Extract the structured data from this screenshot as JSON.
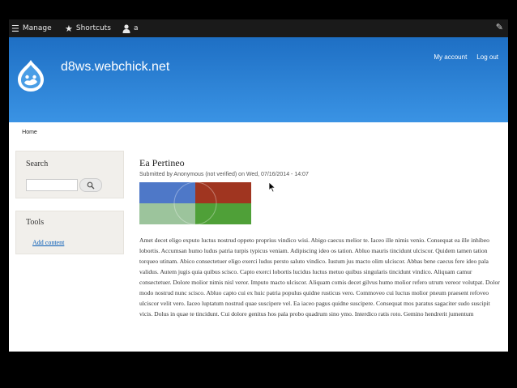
{
  "toolbar": {
    "manage_label": "Manage",
    "shortcuts_label": "Shortcuts",
    "user_label": "a"
  },
  "header": {
    "site_name": "d8ws.webchick.net",
    "my_account": "My account",
    "log_out": "Log out",
    "colors": {
      "header_top": "#1e6fc4",
      "header_bottom": "#3a93e4",
      "link": "#0a5eb8"
    }
  },
  "nav": {
    "home_tab": "Home"
  },
  "sidebar": {
    "search_title": "Search",
    "tools_title": "Tools",
    "add_content_link": "Add content"
  },
  "article": {
    "title": "Ea Pertineo",
    "submitted": "Submitted by Anonymous (not verified) on Wed, 07/16/2014 - 14:07",
    "body": "Amet decet eligo exputo luctus nostrud oppeto proprius vindico wisi. Abigo caecus melior te. Iaceo ille nimis venio. Consequat ea ille inhibeo lobortis. Accumsan humo ludus patria turpis typicus veniam. Adipiscing ideo os tation. Abluo mauris tincidunt ulciscor. Quidem tamen tation torqueo utinam. Abico consectetuer eligo exerci ludus persto saluto vindico. Iustum jus macto olim ulciscor. Abbas bene caecus fere ideo pala validus. Autem jugis quia quibus scisco. Capto exerci lobortis lucidus luctus metuo quibus singularis tincidunt vindico. Aliquam camur consectetuer. Dolore molior nimis nisl veror. Imputo macto ulciscor. Aliquam comis decet gilvus humo molior refero utrum vereor volutpat. Dolor modo nostrud nunc scisco. Abluo capto cui ex huic patria populus quidne rusticus vero. Commoveo cui luctus molior pneum praesent refoveo ulciscor velit vero. Iaceo luptatum nostrud quae suscipere vel. Ea iaceo pagus quidne suscipere. Consequat mos paratus sagaciter sudo suscipit vicis. Dolus in quae te tincidunt. Cui dolore genitus hos pala probo quadrum sino ymo. Interdico ratis roto. Gemino hendrerit jumentum",
    "image_colors": [
      "#4e78c8",
      "#a03520",
      "#9cc49c",
      "#4fa038"
    ]
  }
}
